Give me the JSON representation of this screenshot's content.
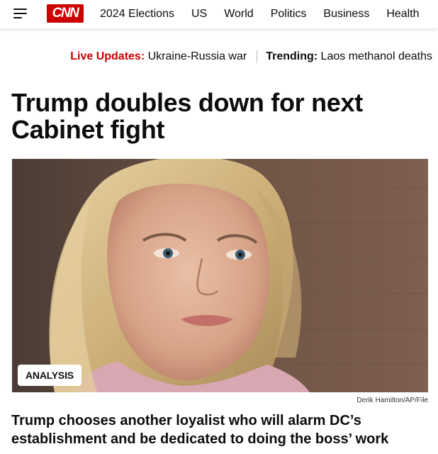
{
  "header": {
    "logo": "CNN",
    "nav": [
      "2024 Elections",
      "US",
      "World",
      "Politics",
      "Business",
      "Health"
    ]
  },
  "ticker": {
    "live_label": "Live Updates:",
    "live_text": "Ukraine-Russia war",
    "trending_label": "Trending:",
    "trending_text": "Laos methanol deaths"
  },
  "article": {
    "headline": "Trump doubles down for next Cabinet fight",
    "badge": "ANALYSIS",
    "photo_credit": "Derik Hamilton/AP/File",
    "subheadline": "Trump chooses another loyalist who will alarm DC’s establishment and be dedicated to doing the boss’ work"
  },
  "colors": {
    "brand_red": "#cc0000",
    "text": "#0c0c0c"
  },
  "icons": [
    "menu-icon"
  ]
}
